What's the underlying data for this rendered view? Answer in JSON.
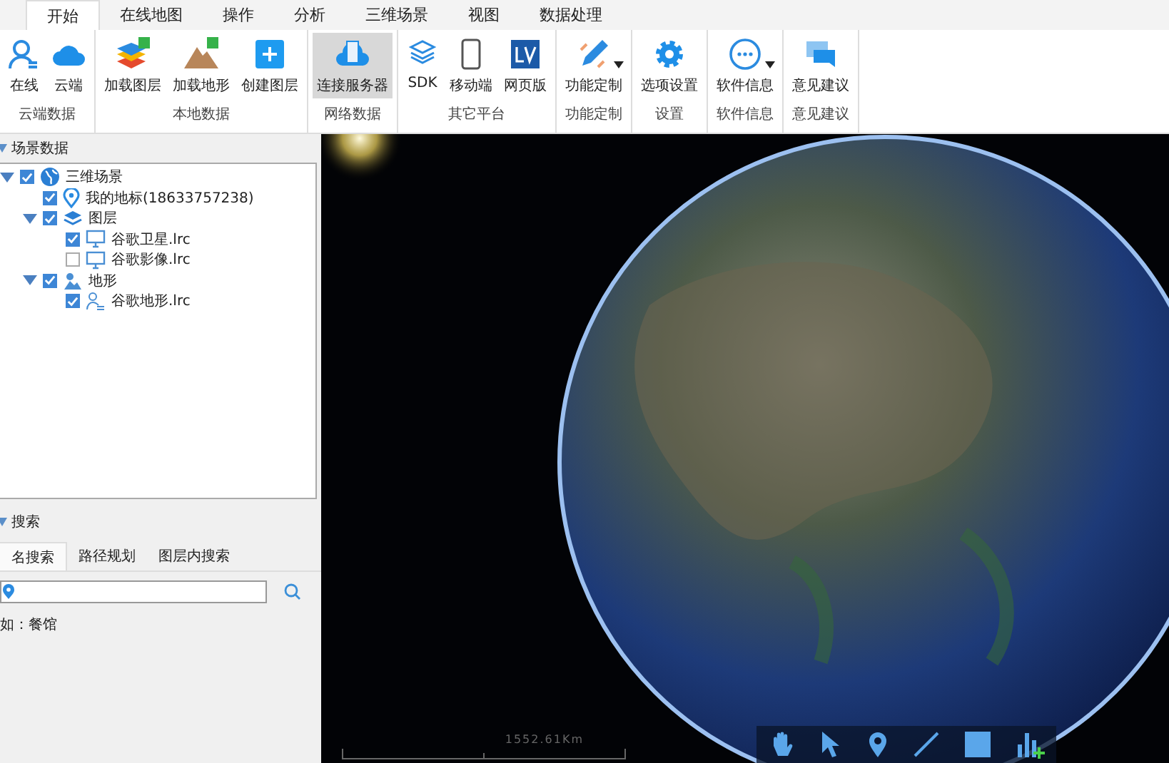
{
  "tabs": [
    {
      "label": "开始",
      "selected": true
    },
    {
      "label": "在线地图",
      "selected": false
    },
    {
      "label": "操作",
      "selected": false
    },
    {
      "label": "分析",
      "selected": false
    },
    {
      "label": "三维场景",
      "selected": false
    },
    {
      "label": "视图",
      "selected": false
    },
    {
      "label": "数据处理",
      "selected": false
    }
  ],
  "ribbon": [
    {
      "label": "云端数据",
      "buttons": [
        {
          "label": "在线",
          "kind": "user",
          "selected": false,
          "dropdown": false
        },
        {
          "label": "云端",
          "kind": "cloud",
          "selected": false,
          "dropdown": false
        }
      ]
    },
    {
      "label": "本地数据",
      "buttons": [
        {
          "label": "加载图层",
          "kind": "layers",
          "selected": false,
          "dropdown": false
        },
        {
          "label": "加载地形",
          "kind": "terrain",
          "selected": false,
          "dropdown": false
        },
        {
          "label": "创建图层",
          "kind": "plus",
          "selected": false,
          "dropdown": false
        }
      ]
    },
    {
      "label": "网络数据",
      "buttons": [
        {
          "label": "连接服务器",
          "kind": "server",
          "selected": true,
          "dropdown": false
        }
      ]
    },
    {
      "label": "其它平台",
      "buttons": [
        {
          "label": "SDK",
          "kind": "sdk",
          "selected": false,
          "dropdown": false
        },
        {
          "label": "移动端",
          "kind": "phone",
          "selected": false,
          "dropdown": false
        },
        {
          "label": "网页版",
          "kind": "web",
          "selected": false,
          "dropdown": false
        }
      ]
    },
    {
      "label": "功能定制",
      "buttons": [
        {
          "label": "功能定制",
          "kind": "pencil",
          "selected": false,
          "dropdown": true
        }
      ]
    },
    {
      "label": "设置",
      "buttons": [
        {
          "label": "选项设置",
          "kind": "gear",
          "selected": false,
          "dropdown": false
        }
      ]
    },
    {
      "label": "软件信息",
      "buttons": [
        {
          "label": "软件信息",
          "kind": "info",
          "selected": false,
          "dropdown": true
        }
      ]
    },
    {
      "label": "意见建议",
      "buttons": [
        {
          "label": "意见建议",
          "kind": "chat",
          "selected": false,
          "dropdown": false
        }
      ]
    }
  ],
  "scene_panel": {
    "title": "场景数据",
    "expanded": true,
    "tree": [
      {
        "label": "三维场景",
        "kind": "globe",
        "checked": true,
        "expanded": true,
        "children": [
          {
            "label": "我的地标(18633757238)",
            "kind": "pin",
            "checked": true
          },
          {
            "label": "图层",
            "kind": "layers",
            "checked": true,
            "expanded": true,
            "children": [
              {
                "label": "谷歌卫星.lrc",
                "kind": "monitor",
                "checked": true
              },
              {
                "label": "谷歌影像.lrc",
                "kind": "monitor",
                "checked": false
              }
            ]
          },
          {
            "label": "地形",
            "kind": "terrain",
            "checked": true,
            "expanded": true,
            "children": [
              {
                "label": "谷歌地形.lrc",
                "kind": "person",
                "checked": true
              }
            ]
          }
        ]
      }
    ]
  },
  "search_panel": {
    "title": "搜索",
    "expanded": true,
    "tabs": [
      {
        "label": "名搜索",
        "selected": true
      },
      {
        "label": "路径规划",
        "selected": false
      },
      {
        "label": "图层内搜索",
        "selected": false
      }
    ],
    "hint": "如：餐馆"
  },
  "map": {
    "scale_label": "1552.61Km",
    "tools": [
      {
        "kind": "hand"
      },
      {
        "kind": "pointer"
      },
      {
        "kind": "pin"
      },
      {
        "kind": "line"
      },
      {
        "kind": "square"
      },
      {
        "kind": "chart"
      }
    ]
  }
}
